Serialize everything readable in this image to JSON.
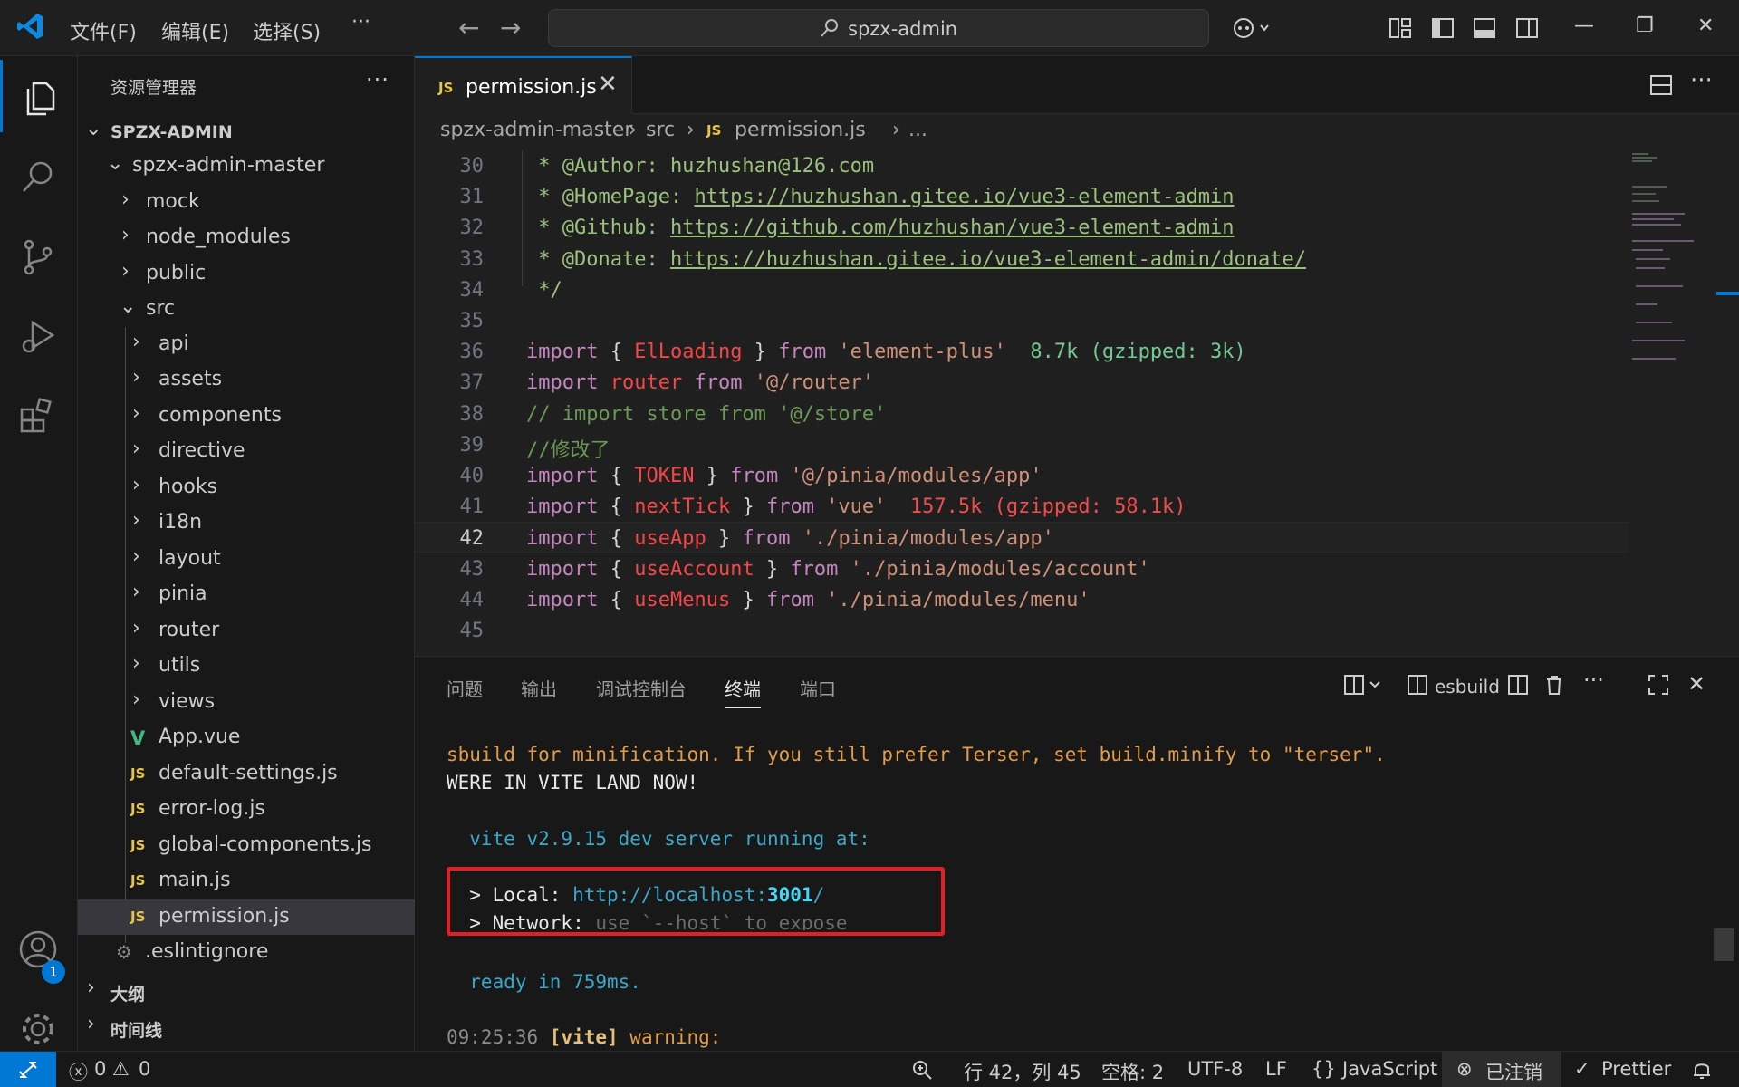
{
  "titlebar": {
    "menu": [
      "文件(F)",
      "编辑(E)",
      "选择(S)"
    ],
    "more": "···",
    "search": "spzx-admin"
  },
  "sidebar": {
    "title": "资源管理器",
    "more": "···",
    "root": "SPZX-ADMIN",
    "project": "spzx-admin-master",
    "folders_top": [
      "mock",
      "node_modules",
      "public"
    ],
    "src": "src",
    "src_folders": [
      "api",
      "assets",
      "components",
      "directive",
      "hooks",
      "i18n",
      "layout",
      "pinia",
      "router",
      "utils",
      "views"
    ],
    "src_files": [
      {
        "name": "App.vue",
        "icon": "V"
      },
      {
        "name": "default-settings.js",
        "icon": "JS"
      },
      {
        "name": "error-log.js",
        "icon": "JS"
      },
      {
        "name": "global-components.js",
        "icon": "JS"
      },
      {
        "name": "main.js",
        "icon": "JS"
      },
      {
        "name": "permission.js",
        "icon": "JS"
      }
    ],
    "eslintignore": ".eslintignore",
    "outline": "大纲",
    "timeline": "时间线"
  },
  "activity": {
    "accounts_badge": "1"
  },
  "editor": {
    "tab": {
      "icon": "JS",
      "label": "permission.js",
      "close": "✕"
    },
    "breadcrumb": [
      "spzx-admin-master",
      "src",
      "JS",
      "permission.js",
      "..."
    ],
    "active_line": "42",
    "lines": [
      {
        "n": "30",
        "parts": [
          [
            "doc",
            " * @Author: huzhushan@126.com"
          ]
        ]
      },
      {
        "n": "31",
        "parts": [
          [
            "doc",
            " * @HomePage: "
          ],
          [
            "url",
            "https://huzhushan.gitee.io/vue3-element-admin"
          ]
        ]
      },
      {
        "n": "32",
        "parts": [
          [
            "doc",
            " * @Github: "
          ],
          [
            "url",
            "https://github.com/huzhushan/vue3-element-admin"
          ]
        ]
      },
      {
        "n": "33",
        "parts": [
          [
            "doc",
            " * @Donate: "
          ],
          [
            "url",
            "https://huzhushan.gitee.io/vue3-element-admin/donate/"
          ]
        ]
      },
      {
        "n": "34",
        "parts": [
          [
            "doc",
            " */"
          ]
        ]
      },
      {
        "n": "35",
        "parts": []
      },
      {
        "n": "36",
        "parts": [
          [
            "kw",
            "import"
          ],
          [
            "pun",
            " { "
          ],
          [
            "ident",
            "ElLoading"
          ],
          [
            "pun",
            " } "
          ],
          [
            "kw",
            "from"
          ],
          [
            "pun",
            " "
          ],
          [
            "str",
            "'element-plus'"
          ],
          [
            "sizeg",
            "  8.7k (gzipped: 3k)"
          ]
        ]
      },
      {
        "n": "37",
        "parts": [
          [
            "kw",
            "import"
          ],
          [
            "pun",
            " "
          ],
          [
            "ident",
            "router"
          ],
          [
            "pun",
            " "
          ],
          [
            "kw",
            "from"
          ],
          [
            "pun",
            " "
          ],
          [
            "str",
            "'@/router'"
          ]
        ]
      },
      {
        "n": "38",
        "parts": [
          [
            "cmt",
            "// import store from '@/store'"
          ]
        ]
      },
      {
        "n": "39",
        "parts": [
          [
            "cmt",
            "//修改了"
          ]
        ]
      },
      {
        "n": "40",
        "parts": [
          [
            "kw",
            "import"
          ],
          [
            "pun",
            " { "
          ],
          [
            "ident",
            "TOKEN"
          ],
          [
            "pun",
            " } "
          ],
          [
            "kw",
            "from"
          ],
          [
            "pun",
            " "
          ],
          [
            "str",
            "'@/pinia/modules/app'"
          ]
        ]
      },
      {
        "n": "41",
        "parts": [
          [
            "kw",
            "import"
          ],
          [
            "pun",
            " { "
          ],
          [
            "ident",
            "nextTick"
          ],
          [
            "pun",
            " } "
          ],
          [
            "kw",
            "from"
          ],
          [
            "pun",
            " "
          ],
          [
            "str",
            "'vue'"
          ],
          [
            "sizer",
            "  157.5k (gzipped: 58.1k)"
          ]
        ]
      },
      {
        "n": "42",
        "parts": [
          [
            "kw",
            "import"
          ],
          [
            "pun",
            " { "
          ],
          [
            "ident",
            "useApp"
          ],
          [
            "pun",
            " } "
          ],
          [
            "kw",
            "from"
          ],
          [
            "pun",
            " "
          ],
          [
            "str",
            "'./pinia/modules/app'"
          ]
        ]
      },
      {
        "n": "43",
        "parts": [
          [
            "kw",
            "import"
          ],
          [
            "pun",
            " { "
          ],
          [
            "ident",
            "useAccount"
          ],
          [
            "pun",
            " } "
          ],
          [
            "kw",
            "from"
          ],
          [
            "pun",
            " "
          ],
          [
            "str",
            "'./pinia/modules/account'"
          ]
        ]
      },
      {
        "n": "44",
        "parts": [
          [
            "kw",
            "import"
          ],
          [
            "pun",
            " { "
          ],
          [
            "ident",
            "useMenus"
          ],
          [
            "pun",
            " } "
          ],
          [
            "kw",
            "from"
          ],
          [
            "pun",
            " "
          ],
          [
            "str",
            "'./pinia/modules/menu'"
          ]
        ]
      },
      {
        "n": "45",
        "parts": []
      }
    ]
  },
  "panel": {
    "tabs": [
      "问题",
      "输出",
      "调试控制台",
      "终端",
      "端口"
    ],
    "active_tab": "终端",
    "terminal_name": "esbuild",
    "terminal": {
      "line1": "sbuild for minification. If you still prefer Terser, set build.minify to \"terser\".",
      "line2": "WERE IN VITE LAND NOW!",
      "line3": "  vite v2.9.15 dev server running at:",
      "local_prefix": "  > Local: ",
      "local_url_a": "http://localhost:",
      "local_port": "3001",
      "local_url_b": "/",
      "network_prefix": "  > Network: ",
      "network_value": "use `--host` to expose",
      "ready": "  ready in 759ms.",
      "warn_time": "09:25:36 ",
      "warn_tag": "[vite]",
      "warn_text": " warning:"
    }
  },
  "statusbar": {
    "errors": "0",
    "warnings": "0",
    "position": "行 42，列 45",
    "spaces": "空格: 2",
    "encoding": "UTF-8",
    "eol": "LF",
    "language": "JavaScript",
    "account": "已注销",
    "prettier": "Prettier"
  },
  "colors": {
    "accent": "#0078d4",
    "highlight_box": "#e51e25"
  }
}
